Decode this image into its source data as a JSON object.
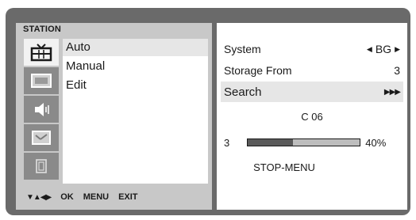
{
  "section": {
    "title": "STATION"
  },
  "sidebar": {
    "icons": [
      {
        "name": "tv-icon",
        "active": true
      },
      {
        "name": "picture-icon",
        "active": false
      },
      {
        "name": "sound-icon",
        "active": false
      },
      {
        "name": "time-icon",
        "active": false
      },
      {
        "name": "special-icon",
        "active": false
      }
    ]
  },
  "menu": {
    "items": [
      {
        "label": "Auto",
        "selected": true
      },
      {
        "label": "Manual",
        "selected": false
      },
      {
        "label": "Edit",
        "selected": false
      }
    ]
  },
  "nav_hints": {
    "arrows": "▼▲◀▶",
    "ok": "OK",
    "menu": "MENU",
    "exit": "EXIT"
  },
  "settings": {
    "system": {
      "label": "System",
      "value": "BG",
      "left_arrow": "◀",
      "right_arrow": "▶"
    },
    "storage_from": {
      "label": "Storage From",
      "value": "3"
    },
    "search": {
      "label": "Search",
      "value": "▶▶▶"
    }
  },
  "search_status": {
    "channel": "C 06",
    "start": "3",
    "progress_percent": 40,
    "progress_label": "40%",
    "stop_hint": "STOP-MENU"
  }
}
